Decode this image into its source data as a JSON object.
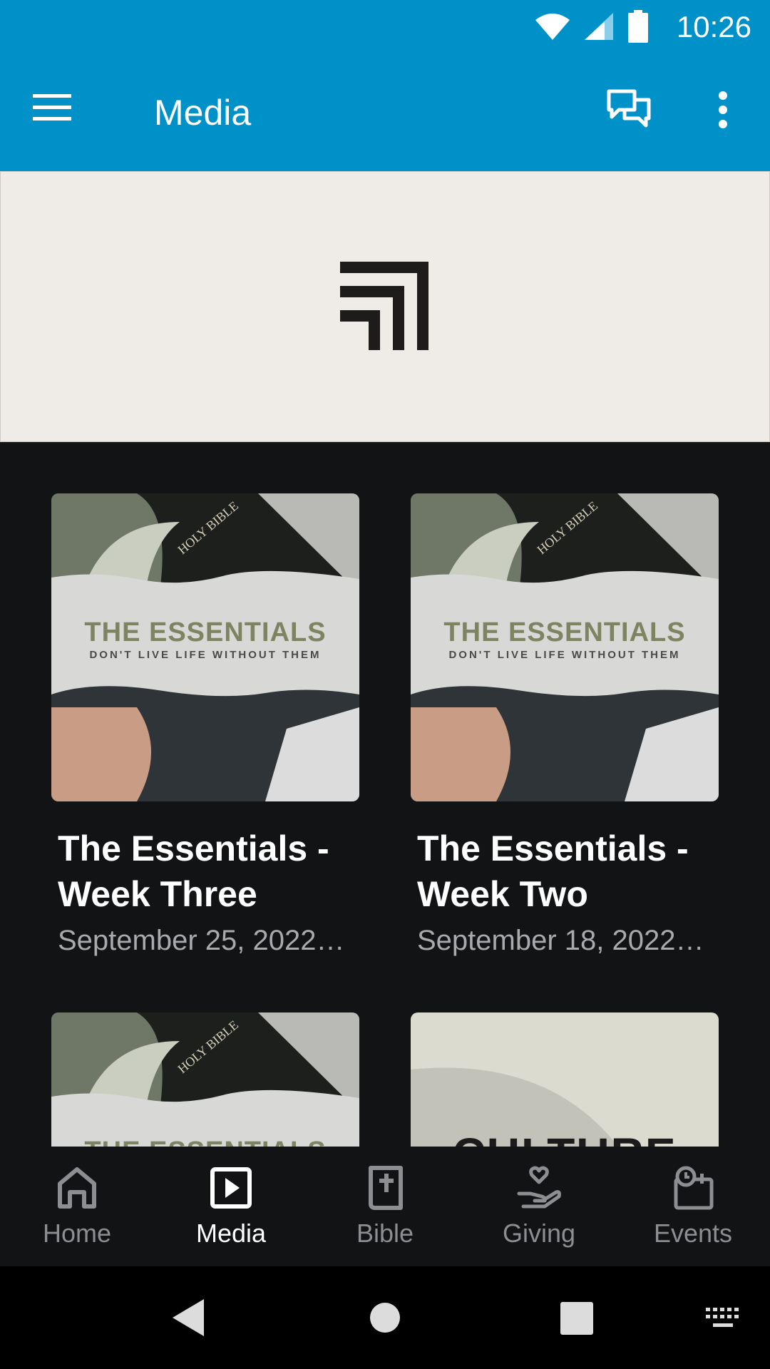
{
  "status_bar": {
    "time": "10:26"
  },
  "app_bar": {
    "title": "Media"
  },
  "media_items": [
    {
      "title": "The Essentials - Week Three",
      "date": "September 25, 2022…",
      "thumb_heading": "THE ESSENTIALS",
      "thumb_subheading": "DON'T LIVE LIFE WITHOUT THEM",
      "thumb_book": "HOLY BIBLE"
    },
    {
      "title": "The Essentials - Week Two",
      "date": "September 18, 2022…",
      "thumb_heading": "THE ESSENTIALS",
      "thumb_subheading": "DON'T LIVE LIFE WITHOUT THEM",
      "thumb_book": "HOLY BIBLE"
    },
    {
      "thumb_heading": "THE ESSENTIALS",
      "thumb_book": "HOLY BIBLE"
    },
    {
      "thumb_heading": "CULTURE"
    }
  ],
  "bottom_nav": [
    {
      "label": "Home",
      "icon": "home-icon"
    },
    {
      "label": "Media",
      "icon": "play-icon",
      "active": true
    },
    {
      "label": "Bible",
      "icon": "bible-icon"
    },
    {
      "label": "Giving",
      "icon": "giving-icon"
    },
    {
      "label": "Events",
      "icon": "events-icon"
    }
  ],
  "colors": {
    "primary": "#0091c9",
    "background": "#121315",
    "banner": "#efebe6",
    "thumb_heading": "#7e8462"
  }
}
